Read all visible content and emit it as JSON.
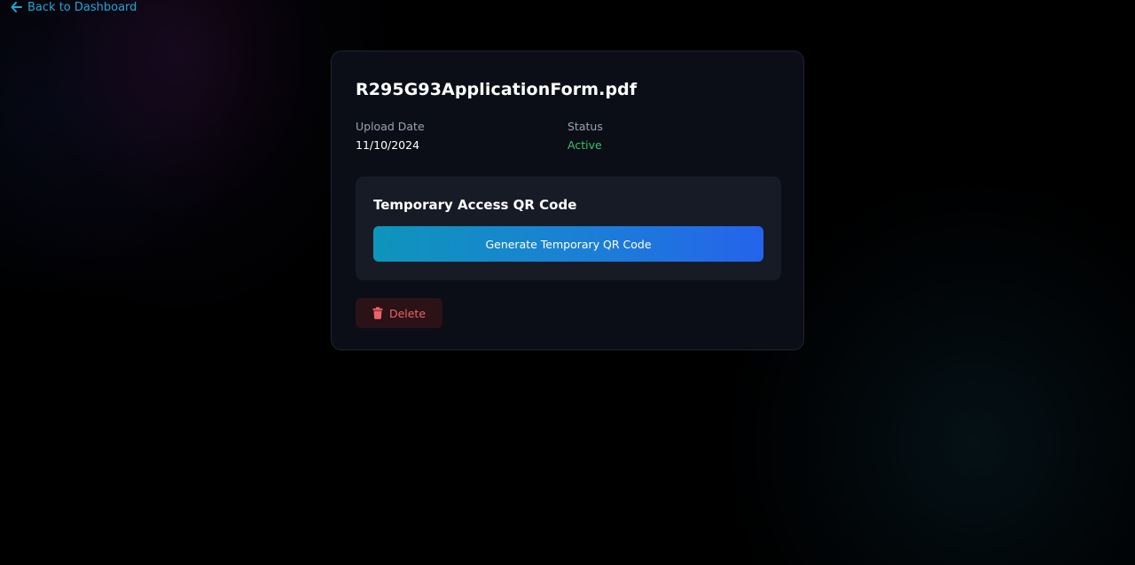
{
  "nav": {
    "back_label": "Back to Dashboard",
    "back_icon": "arrow-left-icon"
  },
  "file": {
    "name": "R295G93ApplicationForm.pdf",
    "upload_date_label": "Upload Date",
    "upload_date_value": "11/10/2024",
    "status_label": "Status",
    "status_value": "Active"
  },
  "qr": {
    "title": "Temporary Access QR Code",
    "button_label": "Generate Temporary QR Code"
  },
  "actions": {
    "delete_label": "Delete",
    "delete_icon": "trash-icon"
  },
  "colors": {
    "accent": "#22a7d6",
    "status_active": "#35c46a",
    "danger": "#f0626a",
    "button_gradient_start": "#0e95bb",
    "button_gradient_end": "#2563eb"
  }
}
